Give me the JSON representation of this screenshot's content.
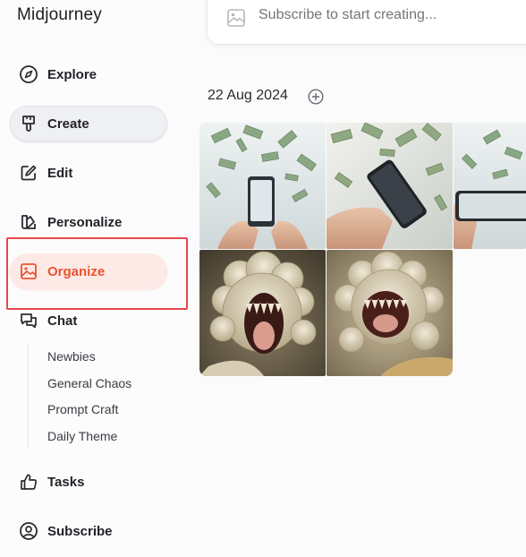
{
  "app": {
    "title": "Midjourney"
  },
  "sidebar": {
    "items": [
      {
        "label": "Explore",
        "icon": "compass-icon"
      },
      {
        "label": "Create",
        "icon": "paintbrush-icon"
      },
      {
        "label": "Edit",
        "icon": "edit-icon"
      },
      {
        "label": "Personalize",
        "icon": "personalize-icon"
      },
      {
        "label": "Organize",
        "icon": "image-icon"
      },
      {
        "label": "Chat",
        "icon": "chat-icon"
      },
      {
        "label": "Tasks",
        "icon": "thumbs-up-icon"
      },
      {
        "label": "Subscribe",
        "icon": "user-circle-icon"
      }
    ],
    "chat_channels": [
      "Newbies",
      "General Chaos",
      "Prompt Craft",
      "Daily Theme"
    ],
    "active_item": "Organize",
    "accent_color": "#e8532f",
    "highlight_color": "#e8464f"
  },
  "topbar": {
    "search_placeholder": "Subscribe to start creating..."
  },
  "gallery": {
    "date_label": "22 Aug 2024",
    "images": [
      {
        "subject": "hands holding phone with flying dollar bills"
      },
      {
        "subject": "hand holding phone with flying dollar bills"
      },
      {
        "subject": "hands holding phone with flying dollar bills"
      },
      {
        "subject": "cauliflower monster with open mouth"
      },
      {
        "subject": "cauliflower monster with open mouth"
      }
    ]
  }
}
